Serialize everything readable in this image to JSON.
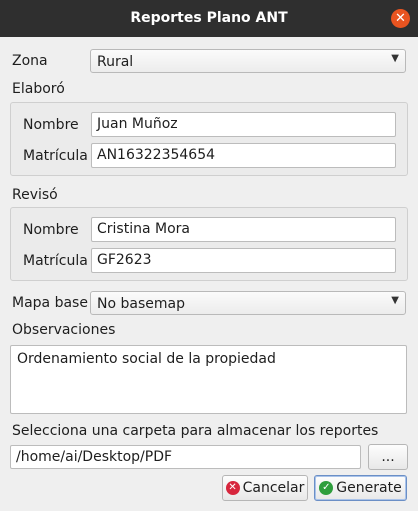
{
  "window": {
    "title": "Reportes Plano ANT",
    "close_glyph": "✕"
  },
  "zona": {
    "label": "Zona",
    "value": "Rural"
  },
  "elaboro": {
    "label": "Elaboró",
    "nombre_label": "Nombre",
    "nombre_value": "Juan Muñoz",
    "matricula_label": "Matrícula",
    "matricula_value": "AN16322354654"
  },
  "reviso": {
    "label": "Revisó",
    "nombre_label": "Nombre",
    "nombre_value": "Cristina Mora",
    "matricula_label": "Matrícula",
    "matricula_value": "GF2623"
  },
  "mapa_base": {
    "label": "Mapa base",
    "value": "No basemap"
  },
  "observaciones": {
    "label": "Observaciones",
    "value": "Ordenamiento social de la propiedad"
  },
  "carpeta": {
    "label": "Selecciona una carpeta para almacenar los reportes",
    "path": "/home/ai/Desktop/PDF",
    "browse_label": "..."
  },
  "buttons": {
    "cancel_label": "Cancelar",
    "generate_label": "Generate"
  },
  "icons": {
    "dropdown": "chevron-down-icon",
    "cancel": "cancel-icon",
    "ok": "check-icon"
  },
  "colors": {
    "titlebar": "#2f2f2f",
    "close": "#e95420",
    "cancel_icon": "#d7263d",
    "ok_icon": "#2e9e3d"
  }
}
